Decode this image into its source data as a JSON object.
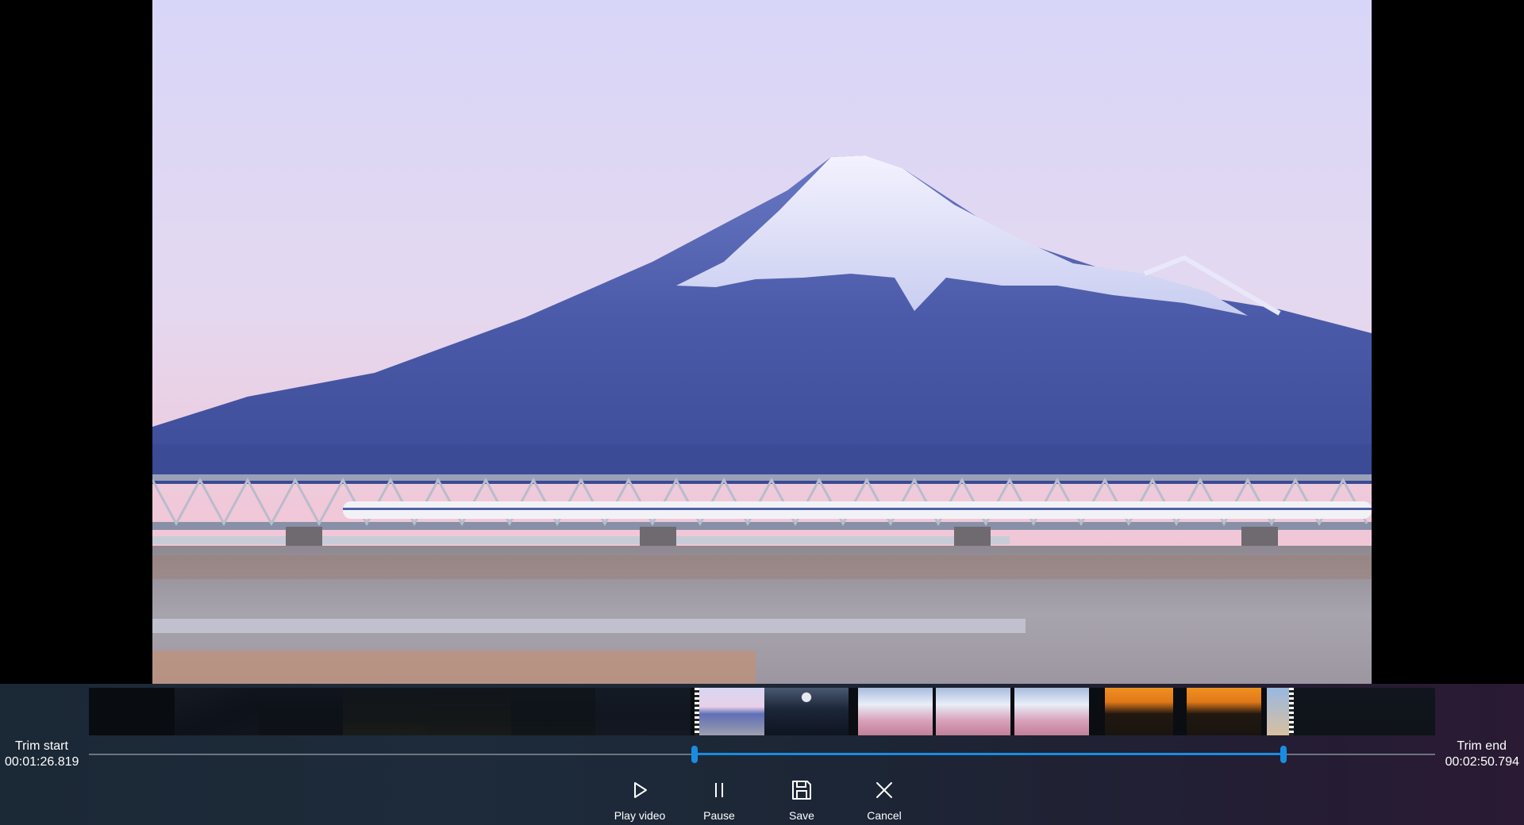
{
  "trim": {
    "start_label": "Trim start",
    "start_time": "00:01:26.819",
    "end_label": "Trim end",
    "end_time": "00:02:50.794"
  },
  "controls": {
    "play_label": "Play video",
    "pause_label": "Pause",
    "save_label": "Save",
    "cancel_label": "Cancel"
  },
  "icons": [
    "play-icon",
    "pause-icon",
    "save-icon",
    "close-icon"
  ],
  "colors": {
    "accent": "#1a8ce0",
    "track": "#6c7480"
  }
}
